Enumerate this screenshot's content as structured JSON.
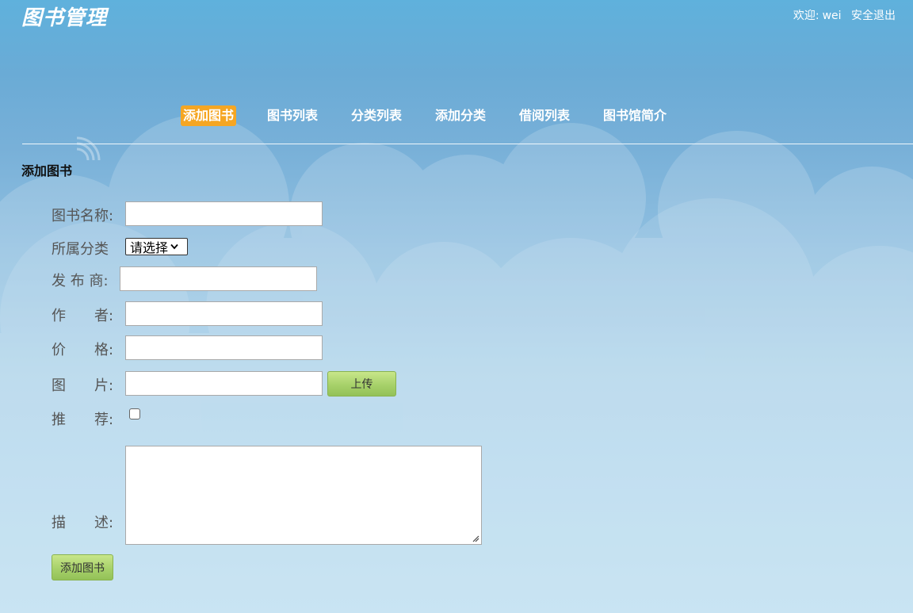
{
  "header": {
    "logo": "图书管理",
    "welcome_prefix": "欢迎:",
    "username": "wei",
    "logout": "安全退出"
  },
  "nav": [
    {
      "label": "添加图书",
      "active": true
    },
    {
      "label": "图书列表",
      "active": false
    },
    {
      "label": "分类列表",
      "active": false
    },
    {
      "label": "添加分类",
      "active": false
    },
    {
      "label": "借阅列表",
      "active": false
    },
    {
      "label": "图书馆简介",
      "active": false
    }
  ],
  "page": {
    "title": "添加图书"
  },
  "form": {
    "name_label": "图书名称:",
    "name_value": "",
    "category_label": "所属分类",
    "category_selected": "请选择",
    "publisher_label": "发 布 商:",
    "publisher_value": "",
    "author_label": "作　　者:",
    "author_value": "",
    "price_label": "价　　格:",
    "price_value": "",
    "image_label": "图　　片:",
    "image_value": "",
    "upload_label": "上传",
    "recommend_label": "推　　荐:",
    "recommend_checked": false,
    "desc_label": "描　　述:",
    "desc_value": "",
    "submit_label": "添加图书"
  },
  "colors": {
    "nav_active_bg": "#f5a623",
    "button_green": "#a7d16a",
    "sky_top": "#5fb1dc",
    "sky_bottom": "#b7dcf0"
  }
}
